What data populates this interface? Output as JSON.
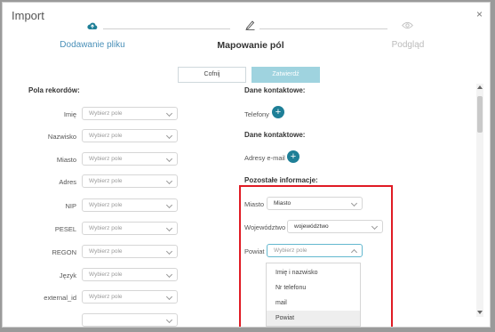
{
  "modal": {
    "title": "Import",
    "close": "×"
  },
  "steps": [
    {
      "label": "Dodawanie pliku",
      "icon": "cloud-upload-icon",
      "state": "done",
      "color": "#4a90b8"
    },
    {
      "label": "Mapowanie pól",
      "icon": "pencil-icon",
      "state": "active",
      "color": "#333333"
    },
    {
      "label": "Podgląd",
      "icon": "eye-icon",
      "state": "pending",
      "color": "#bbbbbb"
    }
  ],
  "buttons": {
    "cancel": "Cofnij",
    "save": "Zatwierdź"
  },
  "left": {
    "heading": "Pola rekordów:",
    "rows": [
      {
        "label": "Imię",
        "placeholder": "Wybierz pole"
      },
      {
        "label": "Nazwisko",
        "placeholder": "Wybierz pole"
      },
      {
        "label": "Miasto",
        "placeholder": "Wybierz pole"
      },
      {
        "label": "Adres",
        "placeholder": "Wybierz pole"
      },
      {
        "label": "NIP",
        "placeholder": "Wybierz pole"
      },
      {
        "label": "PESEL",
        "placeholder": "Wybierz pole"
      },
      {
        "label": "REGON",
        "placeholder": "Wybierz pole"
      },
      {
        "label": "Język",
        "placeholder": "Wybierz pole"
      },
      {
        "label": "external_id",
        "placeholder": "Wybierz pole"
      }
    ]
  },
  "right": {
    "contact1_heading": "Dane kontaktowe:",
    "phones_label": "Telefony",
    "contact2_heading": "Dane kontaktowe:",
    "emails_label": "Adresy e-mail",
    "other_heading": "Pozostałe informacje:",
    "other_rows": [
      {
        "label": "Miasto",
        "value": "Miasto"
      },
      {
        "label": "Województwo",
        "value": "województwo"
      },
      {
        "label": "Powiat",
        "placeholder": "Wybierz pole"
      }
    ],
    "dropdown_options": [
      "Imię i nazwisko",
      "Nr telefonu",
      "mail",
      "Powiat"
    ]
  },
  "colors": {
    "accent": "#1e7f97",
    "highlight_box": "#e01b24",
    "save_button": "#9fd3df"
  }
}
